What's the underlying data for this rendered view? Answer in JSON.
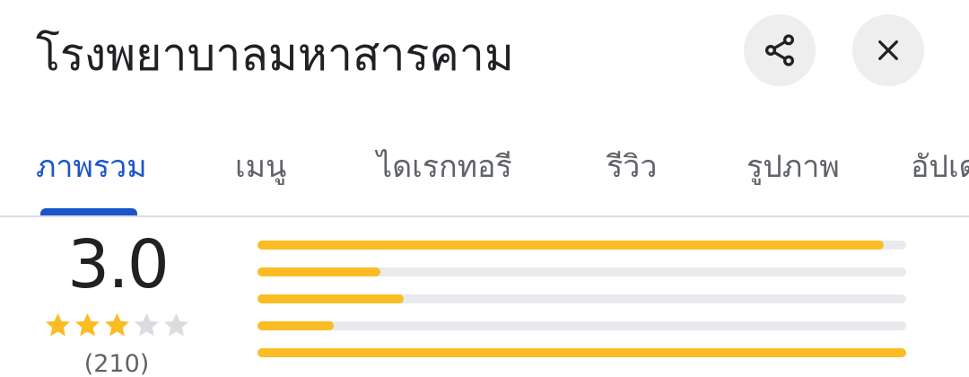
{
  "place": {
    "name": "โรงพยาบาลมหาสารคาม"
  },
  "header": {
    "share_icon": "share-icon",
    "close_icon": "close-icon"
  },
  "tabs": [
    {
      "label": "ภาพรวม",
      "active": true
    },
    {
      "label": "เมนู",
      "active": false
    },
    {
      "label": "ไดเรกทอรี",
      "active": false
    },
    {
      "label": "รีวิว",
      "active": false
    },
    {
      "label": "รูปภาพ",
      "active": false
    },
    {
      "label": "อัปเดต",
      "active": false
    }
  ],
  "rating": {
    "value": "3.0",
    "stars_filled": 3,
    "stars_total": 5,
    "count": "(210)",
    "distribution": [
      {
        "stars": 5,
        "fraction": 0.965
      },
      {
        "stars": 4,
        "fraction": 0.19
      },
      {
        "stars": 3,
        "fraction": 0.225
      },
      {
        "stars": 2,
        "fraction": 0.118
      },
      {
        "stars": 1,
        "fraction": 1.0
      }
    ]
  },
  "colors": {
    "accent": "#1a56c9",
    "star": "#fbbc24",
    "star_empty": "#dadce0",
    "track": "#e8eaed"
  }
}
